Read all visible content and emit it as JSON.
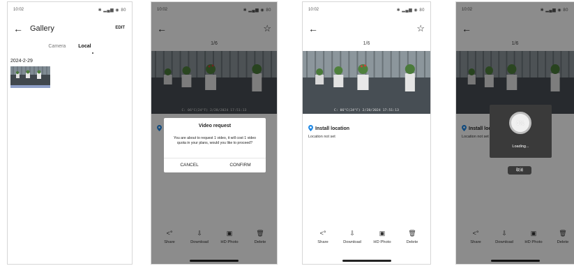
{
  "screens": [
    {
      "time": "10:02",
      "status_icons": "✱ ▂▄▆ ◉ 80",
      "title": "Gallery",
      "edit_label": "EDIT",
      "tabs": [
        "Camera",
        "Local"
      ],
      "active_tab": "Local",
      "date_label": "2024-2-29"
    },
    {
      "time": "10:02",
      "status_icons": "✱ ▂▄▆ ◉ 80",
      "counter": "1/6",
      "timestamp": "C: 06°C(24°F) 2/28/2024 17:51:13",
      "dialog": {
        "title": "Video request",
        "message": "You are about to request 1 video, it will cost 1 video quota in your plans, would you like to proceed?",
        "cancel": "CANCEL",
        "confirm": "CONFIRM"
      },
      "toolbar": [
        "Share",
        "Download",
        "HD Photo",
        "Delete"
      ]
    },
    {
      "time": "10:02",
      "status_icons": "✱ ▂▄▆ ◉ 80",
      "counter": "1/6",
      "timestamp": "C: 06°C(24°F) 2/28/2024 17:51:13",
      "location_title": "Install location",
      "location_sub": "Location not set",
      "toolbar": [
        "Share",
        "Download",
        "HD Photo",
        "Delete"
      ]
    },
    {
      "time": "10:02",
      "status_icons": "✱ ▂▄▆ ◉ 80",
      "counter": "1/6",
      "location_title": "Install location",
      "location_sub": "Location not set",
      "progress": "0%",
      "loading": "Loading...",
      "cancel_pill": "取消",
      "toolbar": [
        "Share",
        "Download",
        "HD Photo",
        "Delete"
      ]
    }
  ],
  "icons": {
    "back": "arrow-left-icon",
    "star": "star-icon",
    "share": "share-icon",
    "download": "download-cloud-icon",
    "hd": "hd-photo-icon",
    "delete": "trash-icon",
    "pin": "location-pin-icon"
  },
  "colors": {
    "accent_blue": "#1e88e5",
    "overlay": "#3a3a3a"
  }
}
